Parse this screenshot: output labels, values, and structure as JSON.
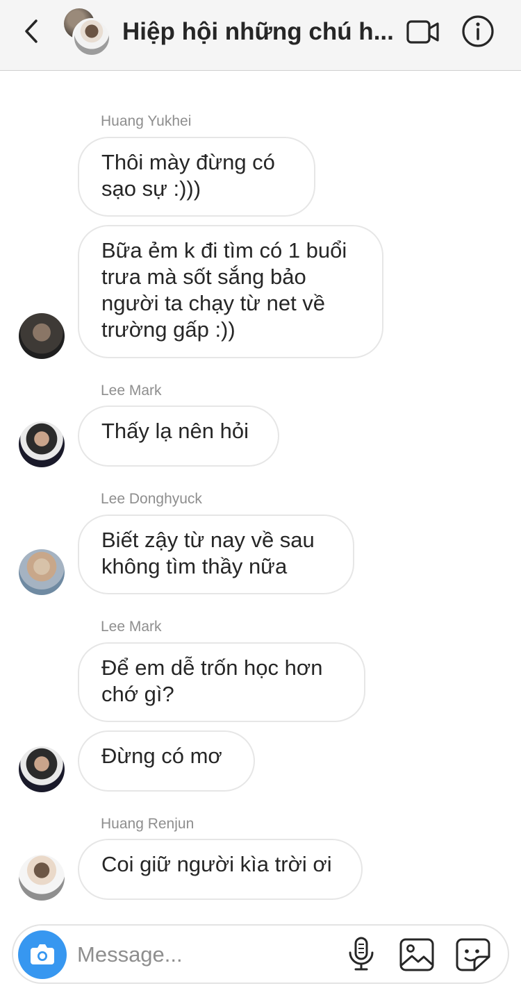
{
  "header": {
    "title": "Hiệp hội những chú h...",
    "back_icon": "chevron-left-icon",
    "video_icon": "video-camera-icon",
    "info_icon": "info-icon"
  },
  "messages": [
    {
      "sender": "Huang Yukhei",
      "bubbles": [
        "Thôi mày đừng có sạo sự :)))",
        "Bữa ẻm k đi tìm có 1 buổi trưa mà sốt sắng bảo người ta chạy từ net về trường gấp :))"
      ]
    },
    {
      "sender": "Lee Mark",
      "bubbles": [
        "Thấy lạ nên hỏi"
      ]
    },
    {
      "sender": "Lee Donghyuck",
      "bubbles": [
        "Biết zậy từ nay về sau không tìm thầy nữa"
      ]
    },
    {
      "sender": "Lee Mark",
      "bubbles": [
        "Để em dễ trốn học hơn chớ gì?",
        "Đừng có mơ"
      ]
    },
    {
      "sender": "Huang Renjun",
      "bubbles": [
        "Coi giữ người kìa trời ơi"
      ]
    }
  ],
  "composer": {
    "placeholder": "Message...",
    "camera_icon": "camera-icon",
    "mic_icon": "microphone-icon",
    "gallery_icon": "gallery-icon",
    "sticker_icon": "sticker-icon"
  },
  "colors": {
    "accent": "#3797f0",
    "header_bg": "#f5f5f5",
    "bubble_border": "#e6e6e6",
    "secondary_text": "#8e8e8e"
  }
}
